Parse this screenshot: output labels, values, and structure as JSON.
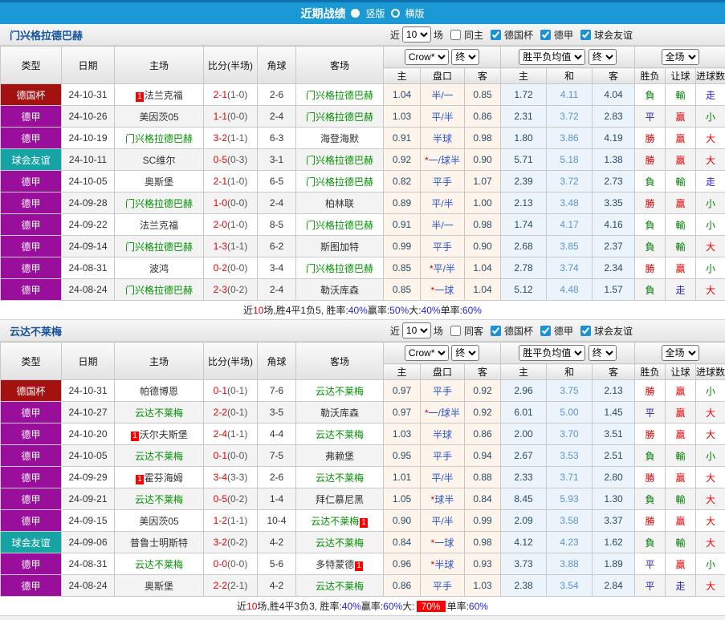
{
  "topbar": {
    "title": "近期战绩",
    "vertical_label": "竖版",
    "horizontal_label": "横版"
  },
  "colors": {
    "cup": "#a31111",
    "liga": "#990e9b",
    "friend": "#15a3a3",
    "accent_blue": "#1b99d4",
    "rank_badge": "#ff0000"
  },
  "table_header": {
    "type": "类型",
    "date": "日期",
    "home": "主场",
    "score": "比分(半场)",
    "corner": "角球",
    "away": "客场",
    "crow_select": "Crow*",
    "final_select": "终",
    "odds_home": "主",
    "odds_name": "盘口",
    "odds_away": "客",
    "avg_select": "胜平负均值",
    "avg_final_select": "终",
    "avg_home": "主",
    "avg_draw": "和",
    "avg_away": "客",
    "full_select": "全场",
    "res_winlose": "胜负",
    "res_handicap": "让球",
    "res_goals": "进球数"
  },
  "sections": [
    {
      "team": "门兴格拉德巴赫",
      "controls": {
        "near": "近",
        "count": "10",
        "unit": "场",
        "same_label": "同主",
        "same_checked": false,
        "leagues": [
          "德国杯",
          "德甲",
          "球会友谊"
        ]
      },
      "rows": [
        {
          "league": "德国杯",
          "lc": "cup",
          "date": "24-10-31",
          "home": "法兰克福",
          "hb": "1",
          "hg": false,
          "score": "2-1",
          "half": "(1-0)",
          "corner": "2-6",
          "away": "门兴格拉德巴赫",
          "ab": "",
          "ag": true,
          "o1": "1.04",
          "star": false,
          "hcap": "半/一",
          "o2": "0.85",
          "a1": "1.72",
          "a2": "4.11",
          "a3": "4.04",
          "r1": "負",
          "c1": "g",
          "r2": "輸",
          "c2": "g",
          "r3": "走",
          "c3": "b"
        },
        {
          "league": "德甲",
          "lc": "liga",
          "date": "24-10-26",
          "home": "美因茨05",
          "hb": "",
          "hg": false,
          "score": "1-1",
          "half": "(0-0)",
          "corner": "2-4",
          "away": "门兴格拉德巴赫",
          "ab": "",
          "ag": true,
          "o1": "1.03",
          "star": false,
          "hcap": "平/半",
          "o2": "0.86",
          "a1": "2.31",
          "a2": "3.72",
          "a3": "2.83",
          "r1": "平",
          "c1": "b",
          "r2": "贏",
          "c2": "r",
          "r3": "小",
          "c3": "g"
        },
        {
          "league": "德甲",
          "lc": "liga",
          "date": "24-10-19",
          "home": "门兴格拉德巴赫",
          "hb": "",
          "hg": true,
          "score": "3-2",
          "half": "(1-1)",
          "corner": "6-3",
          "away": "海登海默",
          "ab": "",
          "ag": false,
          "o1": "0.91",
          "star": false,
          "hcap": "半球",
          "o2": "0.98",
          "a1": "1.80",
          "a2": "3.86",
          "a3": "4.19",
          "r1": "勝",
          "c1": "r",
          "r2": "贏",
          "c2": "r",
          "r3": "大",
          "c3": "r"
        },
        {
          "league": "球会友谊",
          "lc": "friend",
          "date": "24-10-11",
          "home": "SC维尔",
          "hb": "",
          "hg": false,
          "score": "0-5",
          "half": "(0-3)",
          "corner": "3-1",
          "away": "门兴格拉德巴赫",
          "ab": "",
          "ag": true,
          "o1": "0.92",
          "star": true,
          "hcap": "一/球半",
          "o2": "0.90",
          "a1": "5.71",
          "a2": "5.18",
          "a3": "1.38",
          "r1": "勝",
          "c1": "r",
          "r2": "贏",
          "c2": "r",
          "r3": "大",
          "c3": "r"
        },
        {
          "league": "德甲",
          "lc": "liga",
          "date": "24-10-05",
          "home": "奥斯堡",
          "hb": "",
          "hg": false,
          "score": "2-1",
          "half": "(1-0)",
          "corner": "6-5",
          "away": "门兴格拉德巴赫",
          "ab": "",
          "ag": true,
          "o1": "0.82",
          "star": false,
          "hcap": "平手",
          "o2": "1.07",
          "a1": "2.39",
          "a2": "3.72",
          "a3": "2.73",
          "r1": "負",
          "c1": "g",
          "r2": "輸",
          "c2": "g",
          "r3": "走",
          "c3": "b"
        },
        {
          "league": "德甲",
          "lc": "liga",
          "date": "24-09-28",
          "home": "门兴格拉德巴赫",
          "hb": "",
          "hg": true,
          "score": "1-0",
          "half": "(0-0)",
          "corner": "2-4",
          "away": "柏林联",
          "ab": "",
          "ag": false,
          "o1": "0.89",
          "star": false,
          "hcap": "平/半",
          "o2": "1.00",
          "a1": "2.13",
          "a2": "3.48",
          "a3": "3.35",
          "r1": "勝",
          "c1": "r",
          "r2": "贏",
          "c2": "r",
          "r3": "小",
          "c3": "g"
        },
        {
          "league": "德甲",
          "lc": "liga",
          "date": "24-09-22",
          "home": "法兰克福",
          "hb": "",
          "hg": false,
          "score": "2-0",
          "half": "(1-0)",
          "corner": "8-5",
          "away": "门兴格拉德巴赫",
          "ab": "",
          "ag": true,
          "o1": "0.91",
          "star": false,
          "hcap": "半/一",
          "o2": "0.98",
          "a1": "1.74",
          "a2": "4.17",
          "a3": "4.16",
          "r1": "負",
          "c1": "g",
          "r2": "輸",
          "c2": "g",
          "r3": "小",
          "c3": "g"
        },
        {
          "league": "德甲",
          "lc": "liga",
          "date": "24-09-14",
          "home": "门兴格拉德巴赫",
          "hb": "",
          "hg": true,
          "score": "1-3",
          "half": "(1-1)",
          "corner": "6-2",
          "away": "斯图加特",
          "ab": "",
          "ag": false,
          "o1": "0.99",
          "star": false,
          "hcap": "平手",
          "o2": "0.90",
          "a1": "2.68",
          "a2": "3.85",
          "a3": "2.37",
          "r1": "負",
          "c1": "g",
          "r2": "輸",
          "c2": "g",
          "r3": "大",
          "c3": "r"
        },
        {
          "league": "德甲",
          "lc": "liga",
          "date": "24-08-31",
          "home": "波鸿",
          "hb": "",
          "hg": false,
          "score": "0-2",
          "half": "(0-0)",
          "corner": "3-4",
          "away": "门兴格拉德巴赫",
          "ab": "",
          "ag": true,
          "o1": "0.85",
          "star": true,
          "hcap": "平/半",
          "o2": "1.04",
          "a1": "2.78",
          "a2": "3.74",
          "a3": "2.34",
          "r1": "勝",
          "c1": "r",
          "r2": "贏",
          "c2": "r",
          "r3": "小",
          "c3": "g"
        },
        {
          "league": "德甲",
          "lc": "liga",
          "date": "24-08-24",
          "home": "门兴格拉德巴赫",
          "hb": "",
          "hg": true,
          "score": "2-3",
          "half": "(0-2)",
          "corner": "2-4",
          "away": "勒沃库森",
          "ab": "",
          "ag": false,
          "o1": "0.85",
          "star": true,
          "hcap": "一球",
          "o2": "1.04",
          "a1": "5.12",
          "a2": "4.48",
          "a3": "1.57",
          "r1": "負",
          "c1": "g",
          "r2": "走",
          "c2": "b",
          "r3": "大",
          "c3": "r"
        }
      ],
      "summary": [
        {
          "t": "近",
          "c": ""
        },
        {
          "t": "10",
          "c": "red"
        },
        {
          "t": "场,胜4平1负5, 胜率:",
          "c": ""
        },
        {
          "t": "40%",
          "c": "blue"
        },
        {
          "t": " 赢率:",
          "c": ""
        },
        {
          "t": "50%",
          "c": "blue"
        },
        {
          "t": " 大:",
          "c": ""
        },
        {
          "t": "40%",
          "c": "blue"
        },
        {
          "t": " 单率:",
          "c": ""
        },
        {
          "t": "60%",
          "c": "blue"
        }
      ]
    },
    {
      "team": "云达不莱梅",
      "controls": {
        "near": "近",
        "count": "10",
        "unit": "场",
        "same_label": "同客",
        "same_checked": false,
        "leagues": [
          "德国杯",
          "德甲",
          "球会友谊"
        ]
      },
      "rows": [
        {
          "league": "德国杯",
          "lc": "cup",
          "date": "24-10-31",
          "home": "帕德博恩",
          "hb": "",
          "hg": false,
          "score": "0-1",
          "half": "(0-1)",
          "corner": "7-6",
          "away": "云达不莱梅",
          "ab": "",
          "ag": true,
          "o1": "0.97",
          "star": false,
          "hcap": "平手",
          "o2": "0.92",
          "a1": "2.96",
          "a2": "3.75",
          "a3": "2.13",
          "r1": "勝",
          "c1": "r",
          "r2": "贏",
          "c2": "r",
          "r3": "小",
          "c3": "g"
        },
        {
          "league": "德甲",
          "lc": "liga",
          "date": "24-10-27",
          "home": "云达不莱梅",
          "hb": "",
          "hg": true,
          "score": "2-2",
          "half": "(0-1)",
          "corner": "3-5",
          "away": "勒沃库森",
          "ab": "",
          "ag": false,
          "o1": "0.97",
          "star": true,
          "hcap": "一/球半",
          "o2": "0.92",
          "a1": "6.01",
          "a2": "5.00",
          "a3": "1.45",
          "r1": "平",
          "c1": "b",
          "r2": "贏",
          "c2": "r",
          "r3": "大",
          "c3": "r"
        },
        {
          "league": "德甲",
          "lc": "liga",
          "date": "24-10-20",
          "home": "沃尔夫斯堡",
          "hb": "1",
          "hg": false,
          "score": "2-4",
          "half": "(1-1)",
          "corner": "4-4",
          "away": "云达不莱梅",
          "ab": "",
          "ag": true,
          "o1": "1.03",
          "star": false,
          "hcap": "半球",
          "o2": "0.86",
          "a1": "2.00",
          "a2": "3.70",
          "a3": "3.51",
          "r1": "勝",
          "c1": "r",
          "r2": "贏",
          "c2": "r",
          "r3": "大",
          "c3": "r"
        },
        {
          "league": "德甲",
          "lc": "liga",
          "date": "24-10-05",
          "home": "云达不莱梅",
          "hb": "",
          "hg": true,
          "score": "0-1",
          "half": "(0-0)",
          "corner": "7-5",
          "away": "弗赖堡",
          "ab": "",
          "ag": false,
          "o1": "0.95",
          "star": false,
          "hcap": "平手",
          "o2": "0.94",
          "a1": "2.67",
          "a2": "3.53",
          "a3": "2.51",
          "r1": "負",
          "c1": "g",
          "r2": "輸",
          "c2": "g",
          "r3": "小",
          "c3": "g"
        },
        {
          "league": "德甲",
          "lc": "liga",
          "date": "24-09-29",
          "home": "霍芬海姆",
          "hb": "1",
          "hg": false,
          "score": "3-4",
          "half": "(3-3)",
          "corner": "2-6",
          "away": "云达不莱梅",
          "ab": "",
          "ag": true,
          "o1": "1.01",
          "star": false,
          "hcap": "平/半",
          "o2": "0.88",
          "a1": "2.33",
          "a2": "3.71",
          "a3": "2.80",
          "r1": "勝",
          "c1": "r",
          "r2": "贏",
          "c2": "r",
          "r3": "大",
          "c3": "r"
        },
        {
          "league": "德甲",
          "lc": "liga",
          "date": "24-09-21",
          "home": "云达不莱梅",
          "hb": "",
          "hg": true,
          "score": "0-5",
          "half": "(0-2)",
          "corner": "1-4",
          "away": "拜仁慕尼黑",
          "ab": "",
          "ag": false,
          "o1": "1.05",
          "star": true,
          "hcap": "球半",
          "o2": "0.84",
          "a1": "8.45",
          "a2": "5.93",
          "a3": "1.30",
          "r1": "負",
          "c1": "g",
          "r2": "輸",
          "c2": "g",
          "r3": "大",
          "c3": "r"
        },
        {
          "league": "德甲",
          "lc": "liga",
          "date": "24-09-15",
          "home": "美因茨05",
          "hb": "",
          "hg": false,
          "score": "1-2",
          "half": "(1-1)",
          "corner": "10-4",
          "away": "云达不莱梅",
          "ab": "1",
          "ag": true,
          "o1": "0.90",
          "star": false,
          "hcap": "平/半",
          "o2": "0.99",
          "a1": "2.09",
          "a2": "3.58",
          "a3": "3.37",
          "r1": "勝",
          "c1": "r",
          "r2": "贏",
          "c2": "r",
          "r3": "大",
          "c3": "r"
        },
        {
          "league": "球会友谊",
          "lc": "friend",
          "date": "24-09-06",
          "home": "普鲁士明斯特",
          "hb": "",
          "hg": false,
          "score": "3-2",
          "half": "(0-2)",
          "corner": "4-2",
          "away": "云达不莱梅",
          "ab": "",
          "ag": true,
          "o1": "0.84",
          "star": true,
          "hcap": "一球",
          "o2": "0.98",
          "a1": "4.12",
          "a2": "4.23",
          "a3": "1.62",
          "r1": "負",
          "c1": "g",
          "r2": "輸",
          "c2": "g",
          "r3": "大",
          "c3": "r"
        },
        {
          "league": "德甲",
          "lc": "liga",
          "date": "24-08-31",
          "home": "云达不莱梅",
          "hb": "",
          "hg": true,
          "score": "0-0",
          "half": "(0-0)",
          "corner": "5-6",
          "away": "多特蒙德",
          "ab": "1",
          "ag": false,
          "o1": "0.96",
          "star": true,
          "hcap": "半球",
          "o2": "0.93",
          "a1": "3.73",
          "a2": "3.88",
          "a3": "1.89",
          "r1": "平",
          "c1": "b",
          "r2": "贏",
          "c2": "r",
          "r3": "小",
          "c3": "g"
        },
        {
          "league": "德甲",
          "lc": "liga",
          "date": "24-08-24",
          "home": "奥斯堡",
          "hb": "",
          "hg": false,
          "score": "2-2",
          "half": "(2-1)",
          "corner": "4-2",
          "away": "云达不莱梅",
          "ab": "",
          "ag": true,
          "o1": "0.86",
          "star": false,
          "hcap": "平手",
          "o2": "1.03",
          "a1": "2.38",
          "a2": "3.54",
          "a3": "2.84",
          "r1": "平",
          "c1": "b",
          "r2": "走",
          "c2": "b",
          "r3": "大",
          "c3": "r"
        }
      ],
      "summary": [
        {
          "t": "近",
          "c": ""
        },
        {
          "t": "10",
          "c": "red"
        },
        {
          "t": "场,胜4平3负3, 胜率:",
          "c": ""
        },
        {
          "t": "40%",
          "c": "blue"
        },
        {
          "t": " 赢率:",
          "c": ""
        },
        {
          "t": "60%",
          "c": "blue"
        },
        {
          "t": " 大:",
          "c": ""
        },
        {
          "t": "70%",
          "c": "redbg"
        },
        {
          "t": " 单率:",
          "c": ""
        },
        {
          "t": "60%",
          "c": "blue"
        }
      ]
    }
  ]
}
